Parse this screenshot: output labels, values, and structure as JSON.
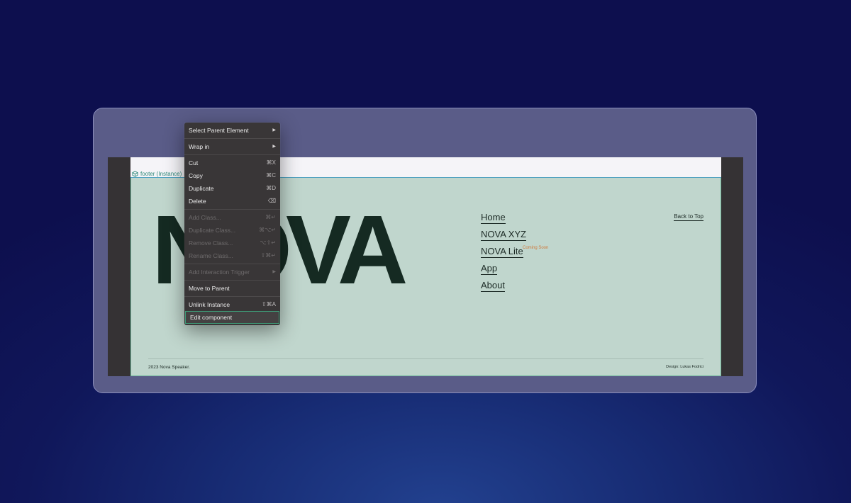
{
  "page": {
    "element_label": "footer (Instance)",
    "logo_text": "NOVA",
    "nav": [
      {
        "label": "Home",
        "badge": ""
      },
      {
        "label": "NOVA XYZ",
        "badge": ""
      },
      {
        "label": "NOVA Lite",
        "badge": "Coming Soon"
      },
      {
        "label": "App",
        "badge": ""
      },
      {
        "label": "About",
        "badge": ""
      }
    ],
    "back_to_top": "Back to Top",
    "copyright": "2023 Nova Speaker.",
    "credit": "Design: Lukas Fodrici"
  },
  "menu": {
    "select_parent": "Select Parent Element",
    "wrap_in": "Wrap in",
    "cut": {
      "label": "Cut",
      "shortcut": "⌘X"
    },
    "copy": {
      "label": "Copy",
      "shortcut": "⌘C"
    },
    "duplicate": {
      "label": "Duplicate",
      "shortcut": "⌘D"
    },
    "delete": {
      "label": "Delete",
      "shortcut": "⌫"
    },
    "add_class": {
      "label": "Add Class...",
      "shortcut": "⌘↵"
    },
    "duplicate_class": {
      "label": "Duplicate Class...",
      "shortcut": "⌘⌥↵"
    },
    "remove_class": {
      "label": "Remove Class...",
      "shortcut": "⌥⇧↵"
    },
    "rename_class": {
      "label": "Rename Class...",
      "shortcut": "⇧⌘↵"
    },
    "add_interaction": "Add Interaction Trigger",
    "move_to_parent": "Move to Parent",
    "unlink": {
      "label": "Unlink Instance",
      "shortcut": "⇧⌘A"
    },
    "edit_component": "Edit component"
  },
  "colors": {
    "background": "#10175a",
    "page_bg": "#c0d6cd",
    "logo": "#152a22",
    "selection_outline": "#3e9b77",
    "badge": "#d07a3c"
  }
}
